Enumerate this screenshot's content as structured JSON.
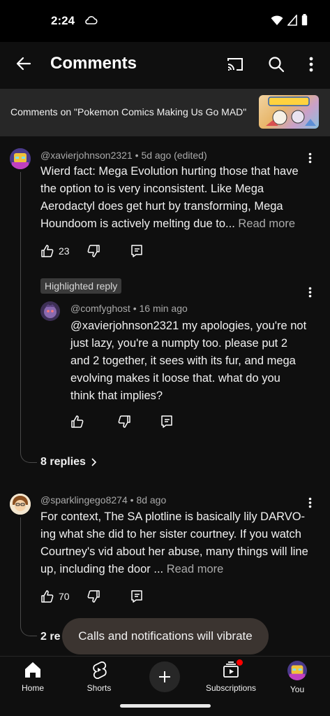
{
  "status_bar": {
    "time": "2:24"
  },
  "app_bar": {
    "title": "Comments"
  },
  "video": {
    "caption": "Comments on \"Pokemon Comics Making Us Go MAD\""
  },
  "comments": [
    {
      "author": "@xavierjohnson2321",
      "age": "5d ago (edited)",
      "text": "Wierd fact: Mega Evolution hurting those that have the option to is very inconsistent. Like Mega Aerodactyl does get hurt by transforming, Mega Houndoom is actively melting due to...",
      "read_more": "Read more",
      "likes": "23",
      "highlight_label": "Highlighted reply",
      "reply": {
        "author": "@comfyghost",
        "age": "16 min ago",
        "text": "@xavierjohnson2321  my apologies, you're not just lazy, you're a numpty too. please put 2 and 2 together, it sees with its fur, and mega evolving makes it loose that. what do you think that implies?"
      },
      "replies_label": "8 replies"
    },
    {
      "author": "@sparklingego8274",
      "age": "8d ago",
      "text": "For context, The SA plotline is basically lily DARVO-ing what she did to her sister courtney. If you watch Courtney's vid about her abuse, many things will line up, including the door ...",
      "read_more": "Read more",
      "likes": "70",
      "replies_label": "2 re"
    }
  ],
  "toast": "Calls and notifications will vibrate",
  "bottom_nav": {
    "home": "Home",
    "shorts": "Shorts",
    "subscriptions": "Subscriptions",
    "you": "You"
  },
  "colors": {
    "background": "#0f0f0f",
    "surface": "#272727",
    "secondary_text": "#aaaaaa",
    "notification_dot": "#ff0000"
  }
}
